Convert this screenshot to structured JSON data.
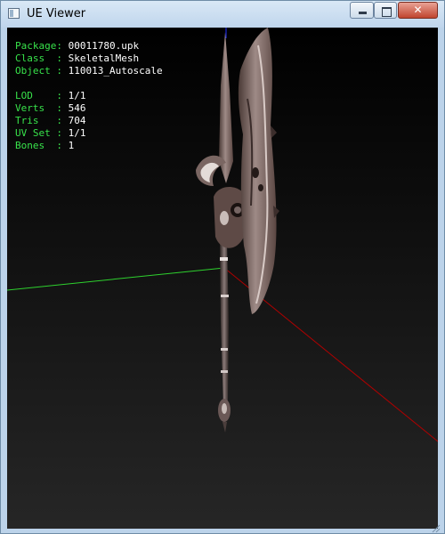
{
  "window": {
    "title": "UE Viewer"
  },
  "info": {
    "group1": [
      {
        "label": "Package",
        "sep": ": ",
        "value": "00011780.upk"
      },
      {
        "label": "Class  ",
        "sep": ": ",
        "value": "SkeletalMesh"
      },
      {
        "label": "Object ",
        "sep": ": ",
        "value": "110013_Autoscale"
      }
    ],
    "group2": [
      {
        "label": "LOD    ",
        "sep": ": ",
        "value": "1/1"
      },
      {
        "label": "Verts  ",
        "sep": ": ",
        "value": "546"
      },
      {
        "label": "Tris   ",
        "sep": ": ",
        "value": "704"
      },
      {
        "label": "UV Set ",
        "sep": ": ",
        "value": "1/1"
      },
      {
        "label": "Bones  ",
        "sep": ": ",
        "value": "1"
      }
    ]
  },
  "colors": {
    "label": "#38e34b",
    "value": "#ffffff",
    "axis_x": "#b00000",
    "axis_y": "#2ed12e",
    "axis_z": "#2030ff"
  },
  "icons": {
    "app": "window-app-icon",
    "minimize": "minimize-icon",
    "maximize": "maximize-icon",
    "close": "close-icon"
  }
}
